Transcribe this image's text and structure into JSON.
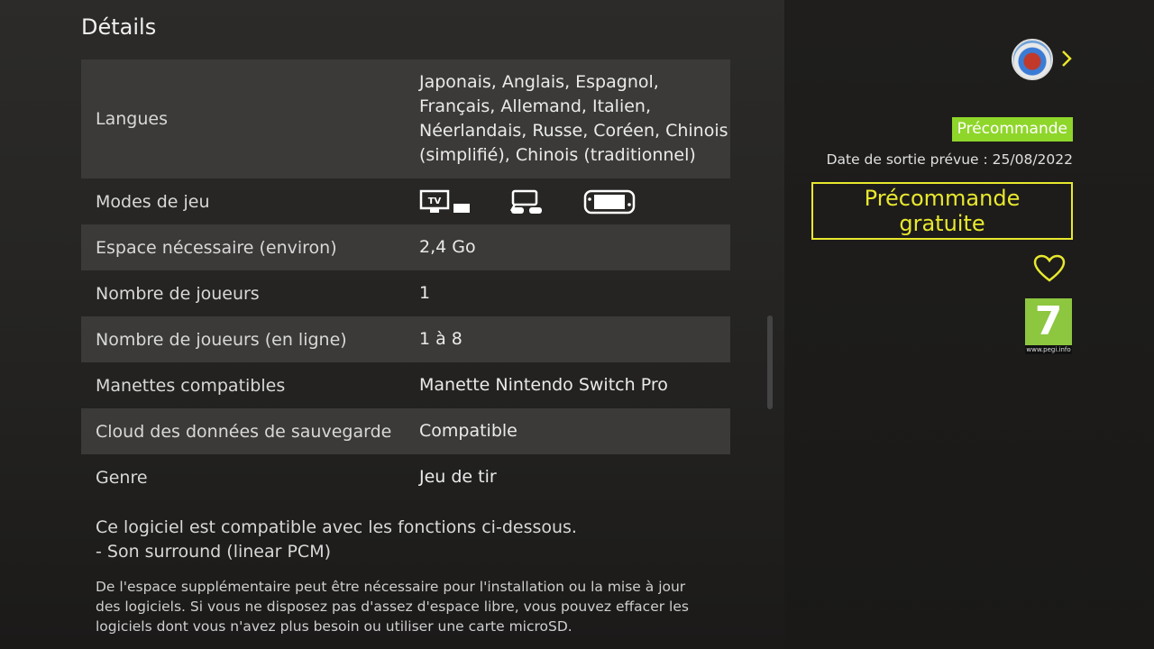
{
  "details": {
    "heading": "Détails",
    "rows": [
      {
        "label": "Langues",
        "value_lines": [
          "Japonais, Anglais, Espagnol,",
          "Français, Allemand, Italien,",
          "Néerlandais, Russe, Coréen, Chinois",
          "(simplifié), Chinois (traditionnel)"
        ]
      },
      {
        "label": "Modes de jeu",
        "modes": [
          "tv-mode-icon",
          "tabletop-mode-icon",
          "handheld-mode-icon"
        ],
        "tv_text": "TV"
      },
      {
        "label": "Espace nécessaire (environ)",
        "value": "2,4 Go"
      },
      {
        "label": "Nombre de joueurs",
        "value": "1"
      },
      {
        "label": "Nombre de joueurs (en ligne)",
        "value": "1 à 8"
      },
      {
        "label": "Manettes compatibles",
        "value": "Manette Nintendo Switch Pro"
      },
      {
        "label": "Cloud des données de sauvegarde",
        "value": "Compatible"
      },
      {
        "label": "Genre",
        "value": "Jeu de tir"
      }
    ],
    "features_lines": [
      "Ce logiciel est compatible avec les fonctions ci-dessous.",
      "- Son surround (linear PCM)"
    ],
    "storage_note": "De l'espace supplémentaire peut être nécessaire pour l'installation ou la mise à jour des logiciels. Si vous ne disposez pas d'assez d'espace libre, vous pouvez effacer les logiciels dont vous n'avez plus besoin ou utiliser une carte microSD."
  },
  "sidebar": {
    "preorder_badge": "Précommande",
    "release_date": "Date de sortie prévue : 25/08/2022",
    "cta_line1": "Précommande",
    "cta_line2": "gratuite",
    "pegi_rating": "7",
    "pegi_site": "www.pegi.info"
  },
  "colors": {
    "accent": "#e8e82e",
    "badge": "#8fd62a",
    "pegi": "#8dc63f"
  }
}
